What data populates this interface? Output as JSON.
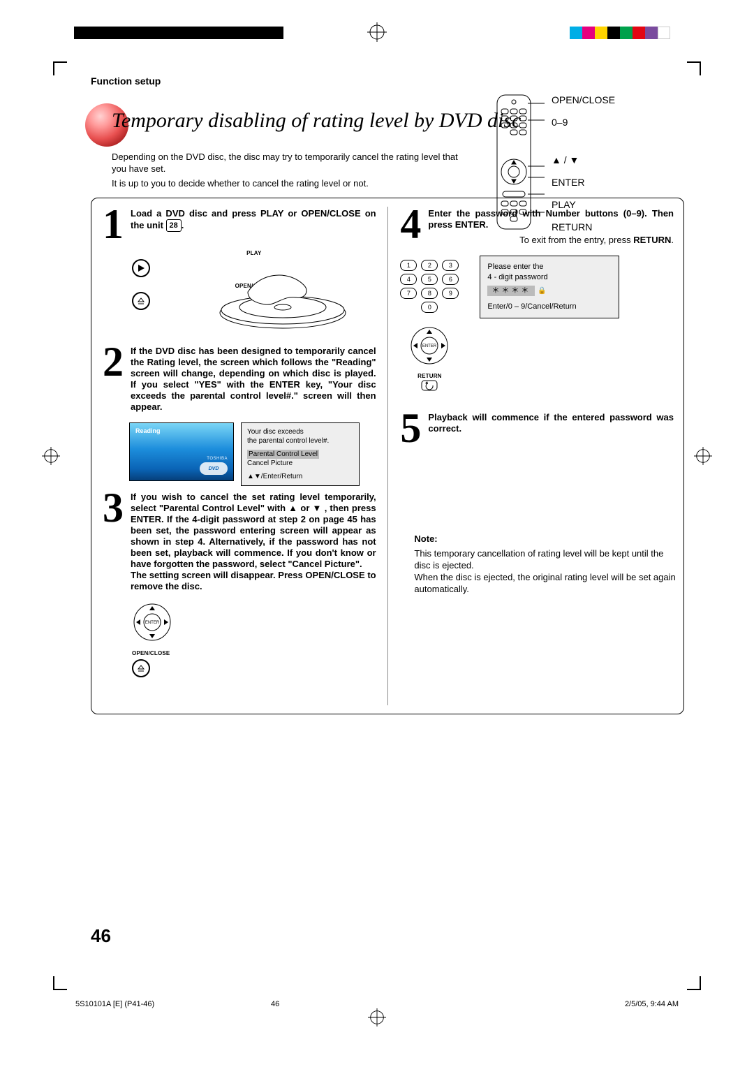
{
  "section_header": "Function setup",
  "title": "Temporary disabling of rating level by DVD disc",
  "intro_line1": "Depending on the DVD disc, the disc may try to temporarily cancel the rating level that you have set.",
  "intro_line2": "It is up to you to decide whether to cancel the rating level or not.",
  "remote": {
    "open_close": "OPEN/CLOSE",
    "digits": "0–9",
    "updown": "▲ / ▼",
    "enter": "ENTER",
    "play": "PLAY",
    "return": "RETURN"
  },
  "steps": {
    "n1": "1",
    "s1a": "Load a DVD disc and press PLAY or OPEN/CLOSE on the unit ",
    "s1_key": "28",
    "s1b": ".",
    "play_label": "PLAY",
    "oc_label": "OPEN/CLOSE",
    "n2": "2",
    "s2": "If the DVD disc has been designed to temporarily cancel the Rating level, the screen which follows the \"Reading\" screen will change, depending on which disc is played. If you select \"YES\" with the ENTER key, \"Your disc exceeds the parental control level#.\" screen will then appear.",
    "osd_reading": "Reading",
    "osd_toshiba": "TOSHIBA",
    "osd_dvd": "DVD",
    "osd_ex1": "Your disc exceeds",
    "osd_ex2": "the parental control level#.",
    "osd_opt1": "Parental Control Level",
    "osd_opt2": "Cancel Picture",
    "osd_hint": "▲▼/Enter/Return",
    "n3": "3",
    "s3": "If you wish to cancel the set rating level temporarily, select \"Parental Control Level\" with ▲ or ▼ , then press ENTER. If the 4-digit password at step 2 on page 45 has been set, the password entering screen will appear as shown in step 4. Alternatively, if the password has not been set, playback will commence. If you don't know or have forgotten the password, select \"Cancel Picture\".",
    "s3b": "The setting screen will disappear. Press OPEN/CLOSE to remove the disc.",
    "enter_label": "ENTER",
    "oc_small": "OPEN/CLOSE",
    "n4": "4",
    "s4a": "Enter the password with Number buttons (0–9). Then press ENTER.",
    "s4_hint": "To exit from the entry, press ",
    "s4_return": "RETURN",
    "kp": [
      "1",
      "2",
      "3",
      "4",
      "5",
      "6",
      "7",
      "8",
      "9",
      "0"
    ],
    "return_small": "RETURN",
    "pw1": "Please enter the",
    "pw2": "4 - digit password",
    "pw_stars": "＊＊＊＊",
    "pw_hint": "Enter/0 – 9/Cancel/Return",
    "n5": "5",
    "s5": "Playback will commence if the entered password was correct."
  },
  "note": {
    "hdr": "Note:",
    "l1": "This temporary cancellation of rating level will be kept until the disc is ejected.",
    "l2": "When the disc is ejected, the original rating level will be set again automatically."
  },
  "page_number": "46",
  "footer": {
    "id": "5S10101A [E] (P41-46)",
    "page": "46",
    "date": "2/5/05, 9:44 AM"
  },
  "reg_colors": [
    "#00aee6",
    "#e6007e",
    "#ffd400",
    "#000000",
    "#00a14b",
    "#e30613",
    "#7a4b9e",
    "#ffffff"
  ]
}
